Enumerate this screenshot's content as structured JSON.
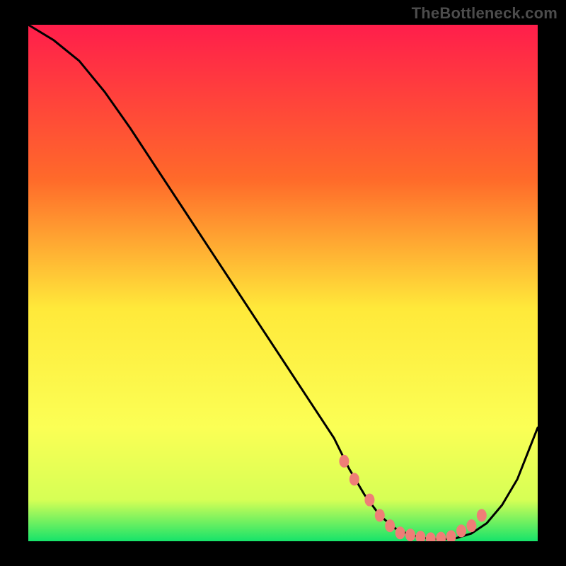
{
  "watermark": "TheBottleneck.com",
  "chart_data": {
    "type": "line",
    "title": "",
    "xlabel": "",
    "ylabel": "",
    "xlim": [
      0,
      100
    ],
    "ylim": [
      0,
      100
    ],
    "grid": false,
    "series": [
      {
        "name": "bottleneck-curve",
        "color": "#000000",
        "x": [
          0,
          5,
          10,
          15,
          20,
          25,
          30,
          35,
          40,
          45,
          50,
          55,
          60,
          63,
          66,
          69,
          72,
          75,
          78,
          81,
          84,
          87,
          90,
          93,
          96,
          100
        ],
        "y": [
          100,
          97,
          93,
          87,
          80,
          72.5,
          65,
          57.5,
          50,
          42.5,
          35,
          27.5,
          20,
          14,
          9,
          5,
          2.5,
          1.2,
          0.6,
          0.4,
          0.6,
          1.5,
          3.5,
          7,
          12,
          22
        ]
      }
    ],
    "markers": {
      "name": "curve-dots",
      "color": "#ef7e77",
      "x": [
        62,
        64,
        67,
        69,
        71,
        73,
        75,
        77,
        79,
        81,
        83,
        85,
        87,
        89
      ],
      "y": [
        15.5,
        12,
        8,
        5,
        3,
        1.6,
        1.2,
        0.8,
        0.5,
        0.6,
        0.9,
        2,
        3,
        5
      ]
    },
    "gradient_colors": {
      "top": "#ff1e4b",
      "upper_mid": "#ff8a2a",
      "mid": "#ffe93a",
      "lower_mid": "#f2ff5a",
      "bottom": "#16e36a"
    }
  }
}
